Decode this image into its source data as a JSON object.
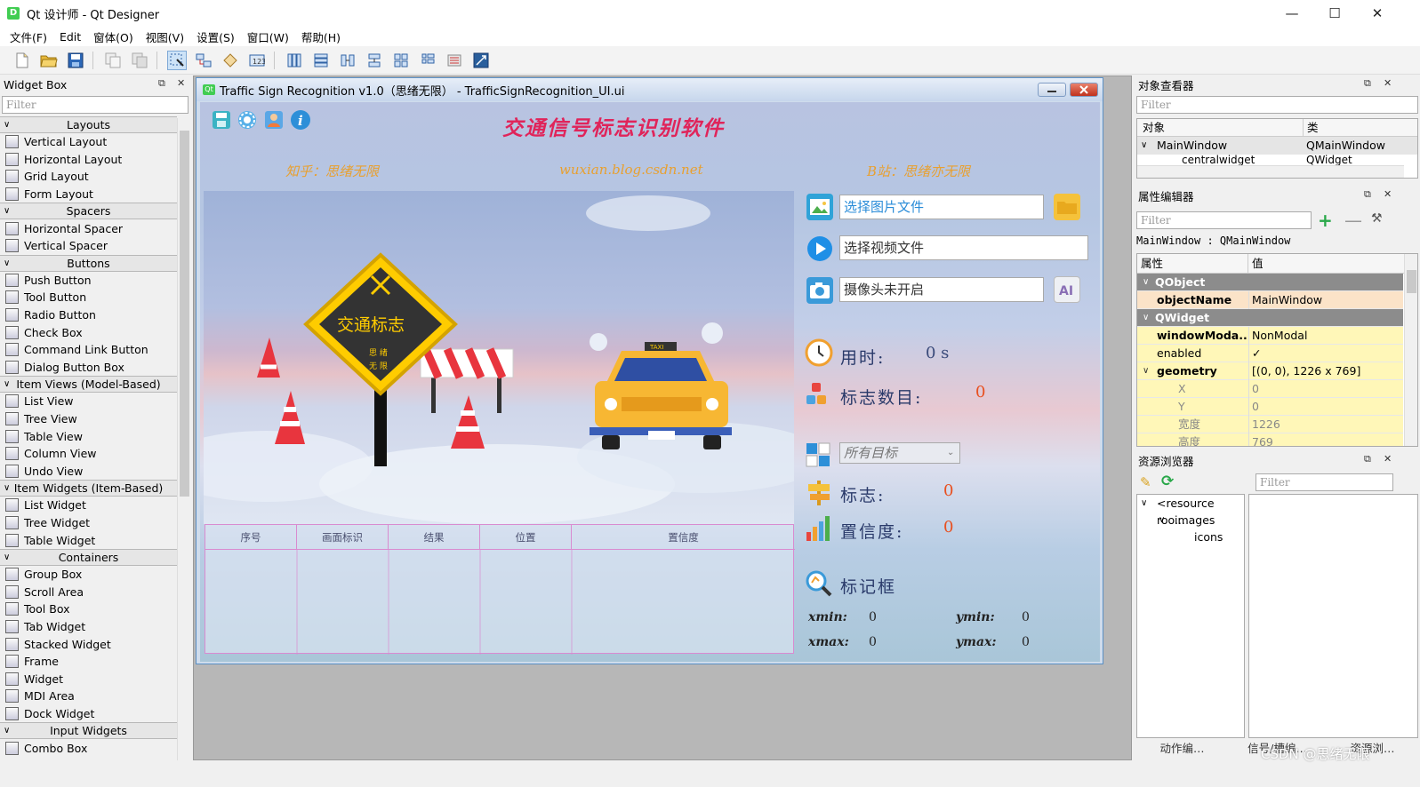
{
  "window": {
    "title": "Qt 设计师 - Qt Designer",
    "app_icon": "D"
  },
  "menu": [
    "文件(F)",
    "Edit",
    "窗体(O)",
    "视图(V)",
    "设置(S)",
    "窗口(W)",
    "帮助(H)"
  ],
  "widget_box": {
    "title": "Widget Box",
    "filter_placeholder": "Filter",
    "categories": [
      {
        "name": "Layouts",
        "items": [
          "Vertical Layout",
          "Horizontal Layout",
          "Grid Layout",
          "Form Layout"
        ]
      },
      {
        "name": "Spacers",
        "items": [
          "Horizontal Spacer",
          "Vertical Spacer"
        ]
      },
      {
        "name": "Buttons",
        "items": [
          "Push Button",
          "Tool Button",
          "Radio Button",
          "Check Box",
          "Command Link Button",
          "Dialog Button Box"
        ]
      },
      {
        "name": "Item Views (Model-Based)",
        "items": [
          "List View",
          "Tree View",
          "Table View",
          "Column View",
          "Undo View"
        ]
      },
      {
        "name": "Item Widgets (Item-Based)",
        "items": [
          "List Widget",
          "Tree Widget",
          "Table Widget"
        ]
      },
      {
        "name": "Containers",
        "items": [
          "Group Box",
          "Scroll Area",
          "Tool Box",
          "Tab Widget",
          "Stacked Widget",
          "Frame",
          "Widget",
          "MDI Area",
          "Dock Widget"
        ]
      },
      {
        "name": "Input Widgets",
        "items": [
          "Combo Box"
        ]
      }
    ]
  },
  "form": {
    "title": "Traffic Sign Recognition v1.0（思绪无限） - TrafficSignRecognition_UI.ui",
    "heading": "交通信号标志识别软件",
    "credit_left": "知乎：思绪无限",
    "credit_mid": "wuxian.blog.csdn.net",
    "credit_right": "B站：思绪亦无限",
    "sign_text": "交通标志",
    "sign_sub1": "思 绪",
    "sign_sub2": "无 限",
    "taxi_label": "TAXI",
    "select_image": "选择图片文件",
    "select_video": "选择视频文件",
    "camera": "摄像头未开启",
    "time_label": "用时:",
    "time_value": "0 s",
    "count_label": "标志数目:",
    "count_value": "0",
    "target_select": "所有目标",
    "sign_label": "标志:",
    "sign_value": "0",
    "conf_label": "置信度:",
    "conf_value": "0",
    "box_label": "标记框",
    "xmin_label": "xmin:",
    "xmin_value": "0",
    "ymin_label": "ymin:",
    "ymin_value": "0",
    "xmax_label": "xmax:",
    "xmax_value": "0",
    "ymax_label": "ymax:",
    "ymax_value": "0",
    "table_headers": [
      "序号",
      "画面标识",
      "结果",
      "位置",
      "置信度"
    ]
  },
  "object_inspector": {
    "title": "对象查看器",
    "filter_placeholder": "Filter",
    "col_object": "对象",
    "col_class": "类",
    "row1_object": "MainWindow",
    "row1_class": "QMainWindow",
    "row2_object": "centralwidget",
    "row2_class": "QWidget"
  },
  "property_editor": {
    "title": "属性编辑器",
    "filter_placeholder": "Filter",
    "context": "MainWindow : QMainWindow",
    "col_prop": "属性",
    "col_val": "值",
    "rows": [
      {
        "name": "QObject",
        "value": ""
      },
      {
        "name": "objectName",
        "value": "MainWindow"
      },
      {
        "name": "QWidget",
        "value": ""
      },
      {
        "name": "windowModa...",
        "value": "NonModal"
      },
      {
        "name": "enabled",
        "value": "✓"
      },
      {
        "name": "geometry",
        "value": "[(0, 0), 1226 x 769]"
      },
      {
        "name": "X",
        "value": "0"
      },
      {
        "name": "Y",
        "value": "0"
      },
      {
        "name": "宽度",
        "value": "1226"
      },
      {
        "name": "高度",
        "value": "769"
      }
    ]
  },
  "resource_browser": {
    "title": "资源浏览器",
    "filter_placeholder": "Filter",
    "tree": [
      "<resource roo...",
      "images",
      "icons"
    ]
  },
  "bottom_tabs": [
    "动作编…",
    "信号/槽编…",
    "资源浏…"
  ],
  "watermark": "CSDN @思绪无限",
  "colors": {
    "heading": "#e0245a",
    "credit": "#e8a030",
    "value": "#e85020",
    "qt_green": "#41cd52"
  }
}
